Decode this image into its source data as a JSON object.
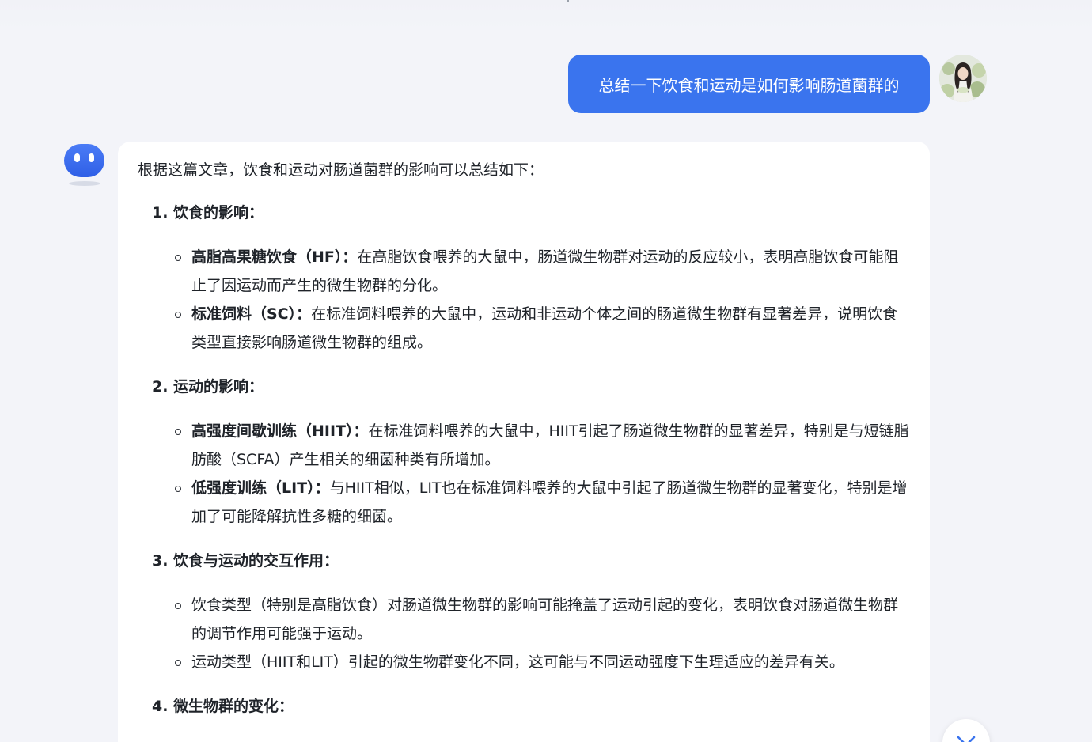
{
  "user_message": "总结一下饮食和运动是如何影响肠道菌群的",
  "answer": {
    "intro": "根据这篇文章，饮食和运动对肠道菌群的影响可以总结如下：",
    "sections": [
      {
        "title": "1. 饮食的影响：",
        "bullets": [
          {
            "strong": "高脂高果糖饮食（HF）：",
            "text": "在高脂饮食喂养的大鼠中，肠道微生物群对运动的反应较小，表明高脂饮食可能阻止了因运动而产生的微生物群的分化。"
          },
          {
            "strong": "标准饲料（SC）：",
            "text": "在标准饲料喂养的大鼠中，运动和非运动个体之间的肠道微生物群有显著差异，说明饮食类型直接影响肠道微生物群的组成。"
          }
        ]
      },
      {
        "title": "2. 运动的影响：",
        "bullets": [
          {
            "strong": "高强度间歇训练（HIIT）：",
            "text": "在标准饲料喂养的大鼠中，HIIT引起了肠道微生物群的显著差异，特别是与短链脂肪酸（SCFA）产生相关的细菌种类有所增加。"
          },
          {
            "strong": "低强度训练（LIT）：",
            "text": "与HIIT相似，LIT也在标准饲料喂养的大鼠中引起了肠道微生物群的显著变化，特别是增加了可能降解抗性多糖的细菌。"
          }
        ]
      },
      {
        "title": "3. 饮食与运动的交互作用：",
        "bullets": [
          {
            "strong": "",
            "text": "饮食类型（特别是高脂饮食）对肠道微生物群的影响可能掩盖了运动引起的变化，表明饮食对肠道微生物群的调节作用可能强于运动。"
          },
          {
            "strong": "",
            "text": "运动类型（HIIT和LIT）引起的微生物群变化不同，这可能与不同运动强度下生理适应的差异有关。"
          }
        ]
      },
      {
        "title": "4. 微生物群的变化：",
        "bullets": []
      }
    ]
  },
  "colors": {
    "background": "#f3f4f9",
    "user_bubble": "#3a74ee",
    "bot_avatar": "#3b6cf0",
    "scroll_chevron": "#3a74ee"
  },
  "icons": {
    "bot": "robot-avatar-icon",
    "user": "user-avatar-photo",
    "scroll": "chevron-down-icon"
  }
}
